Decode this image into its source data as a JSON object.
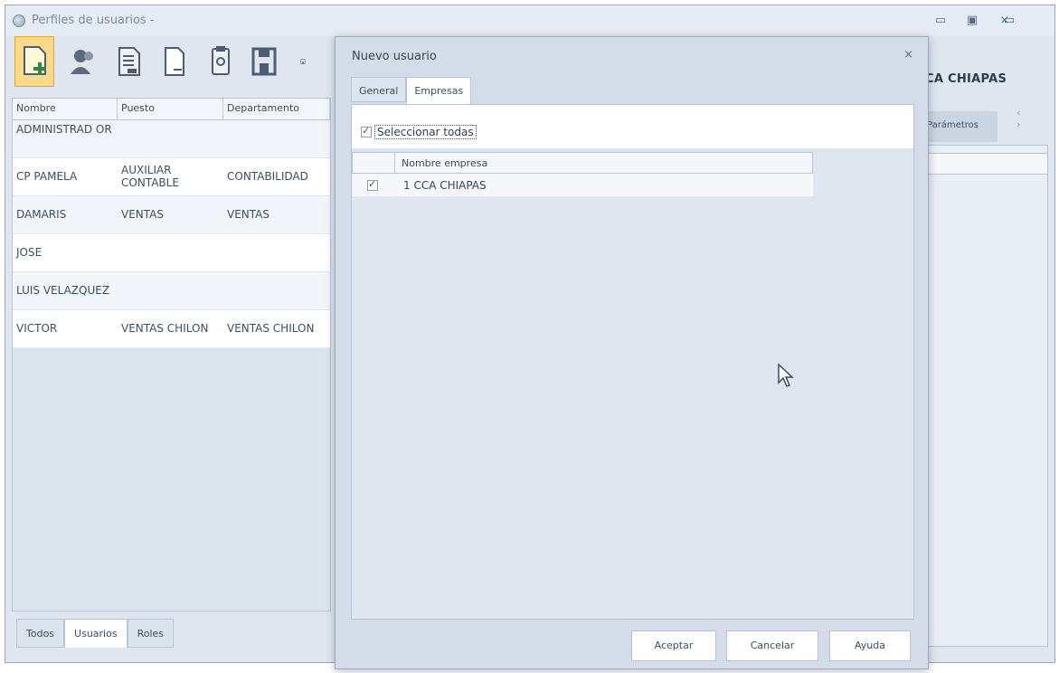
{
  "window": {
    "title": "Perfiles de usuarios -",
    "buttons": {
      "minimize": "▭",
      "maximize": "▣",
      "close": "⨯"
    }
  },
  "toolbar": {
    "items": [
      "new-user-icon",
      "edit-user-icon",
      "document-icon",
      "blank-page-icon",
      "clipboard-icon",
      "save-icon",
      "save-close-icon"
    ]
  },
  "users_grid": {
    "columns": [
      "Nombre",
      "Puesto",
      "Departamento"
    ],
    "rows": [
      {
        "nombre": "ADMINISTRAD OR",
        "puesto": "",
        "departamento": ""
      },
      {
        "nombre": "CP PAMELA",
        "puesto": "AUXILIAR CONTABLE",
        "departamento": "CONTABILIDAD"
      },
      {
        "nombre": "DAMARIS",
        "puesto": "VENTAS",
        "departamento": "VENTAS"
      },
      {
        "nombre": "JOSE",
        "puesto": "",
        "departamento": ""
      },
      {
        "nombre": "LUIS VELAZQUEZ",
        "puesto": "",
        "departamento": ""
      },
      {
        "nombre": "VICTOR",
        "puesto": "VENTAS CHILON",
        "departamento": "VENTAS CHILON"
      }
    ]
  },
  "bottom_tabs": [
    "Todos",
    "Usuarios",
    "Roles"
  ],
  "right_panel": {
    "header": "CA CHIAPAS",
    "tab": "Parámetros"
  },
  "dialog": {
    "title": "Nuevo usuario",
    "close": "⨯",
    "tabs": [
      "General",
      "Empresas"
    ],
    "select_all_label": "Seleccionar todas",
    "grid_header": "Nombre empresa",
    "companies": [
      {
        "checked": true,
        "name": "1 CCA CHIAPAS"
      }
    ],
    "buttons": {
      "accept": "Aceptar",
      "cancel": "Cancelar",
      "help": "Ayuda"
    }
  }
}
